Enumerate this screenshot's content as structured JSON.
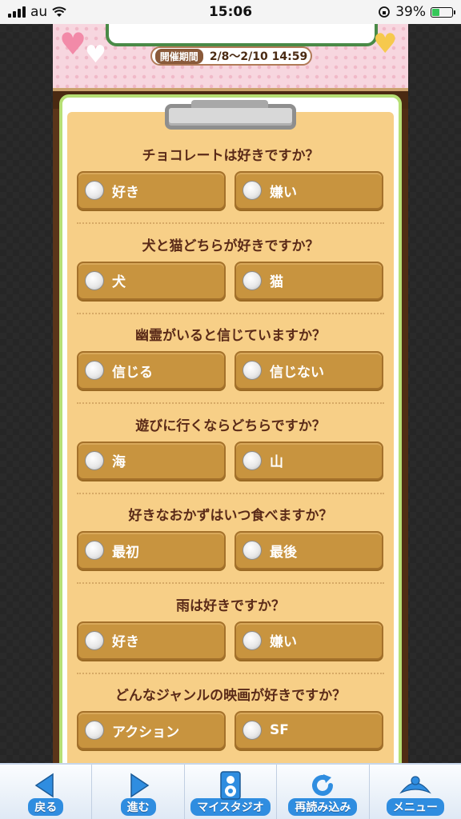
{
  "status_bar": {
    "carrier": "au",
    "time": "15:06",
    "battery_percent": "39%",
    "battery_level": 0.39
  },
  "banner": {
    "period_label": "開催期間",
    "period_value": "2/8～2/10 14:59"
  },
  "questions": [
    {
      "text": "チョコレートは好きですか？",
      "options": [
        "好き",
        "嫌い"
      ]
    },
    {
      "text": "犬と猫どちらが好きですか？",
      "options": [
        "犬",
        "猫"
      ]
    },
    {
      "text": "幽霊がいると信じていますか？",
      "options": [
        "信じる",
        "信じない"
      ]
    },
    {
      "text": "遊びに行くならどちらですか？",
      "options": [
        "海",
        "山"
      ]
    },
    {
      "text": "好きなおかずはいつ食べますか？",
      "options": [
        "最初",
        "最後"
      ]
    },
    {
      "text": "雨は好きですか？",
      "options": [
        "好き",
        "嫌い"
      ]
    },
    {
      "text": "どんなジャンルの映画が好きですか？",
      "options": [
        "アクション",
        "SF"
      ]
    }
  ],
  "nav": {
    "items": [
      {
        "label": "戻る",
        "icon": "back-arrow-icon"
      },
      {
        "label": "進む",
        "icon": "forward-arrow-icon"
      },
      {
        "label": "マイスタジオ",
        "icon": "speaker-icon"
      },
      {
        "label": "再読み込み",
        "icon": "reload-icon"
      },
      {
        "label": "メニュー",
        "icon": "menu-icon"
      }
    ]
  },
  "colors": {
    "accent_blue": "#2f8de0",
    "option_gold": "#c8943f",
    "sheet": "#f7cf87",
    "question_text": "#5a2a18"
  }
}
